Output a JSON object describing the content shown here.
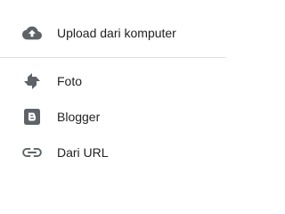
{
  "menu": {
    "items": [
      {
        "label": "Upload dari komputer",
        "icon": "cloud-upload-icon"
      },
      {
        "label": "Foto",
        "icon": "photos-pinwheel-icon"
      },
      {
        "label": "Blogger",
        "icon": "blogger-icon"
      },
      {
        "label": "Dari URL",
        "icon": "link-icon"
      }
    ]
  },
  "colors": {
    "icon": "#5f6368",
    "text": "#212121",
    "divider": "#e0e0e0",
    "background": "#ffffff"
  }
}
